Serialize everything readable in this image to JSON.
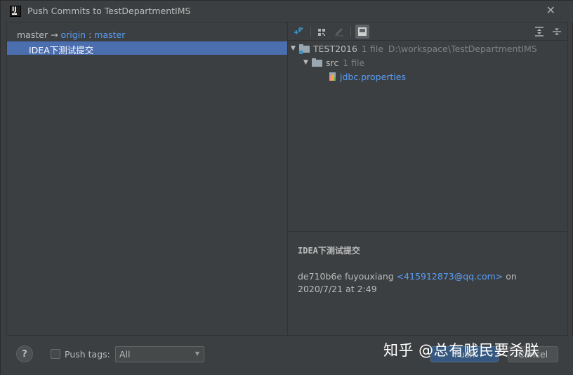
{
  "window": {
    "title": "Push Commits to TestDepartmentIMS",
    "app_icon": "IJ",
    "close_glyph": "✕"
  },
  "left_panel": {
    "local_branch": "master",
    "arrow": " → ",
    "remote": "origin",
    "separator": " : ",
    "remote_branch": "master",
    "commits": [
      {
        "message": "IDEA下测试提交"
      }
    ]
  },
  "toolbar": {
    "icons": [
      "expand-collapse-icon",
      "group-by-icon",
      "edit-icon",
      "preview-icon",
      "expand-all-icon",
      "collapse-all-icon"
    ]
  },
  "tree": {
    "root": {
      "name": "TEST2016",
      "count": "1 file",
      "path": "D:\\workspace\\TestDepartmentIMS"
    },
    "folder": {
      "name": "src",
      "count": "1 file"
    },
    "file": {
      "name": "jdbc.properties"
    }
  },
  "details": {
    "title": "IDEA下测试提交",
    "hash_author": "de710b6e fuyouxiang ",
    "email": "<415912873@qq.com>",
    "date": " on 2020/7/21 at 2:49"
  },
  "bottom": {
    "help": "?",
    "push_tags_label": "Push tags:",
    "tags_value": "All",
    "push_label": "Push",
    "cancel_label": "Cancel",
    "watermark": "知乎 @总有贱民要杀朕"
  },
  "colors": {
    "background": "#3c3f41",
    "selection": "#4b6eaf",
    "link": "#589df6"
  }
}
